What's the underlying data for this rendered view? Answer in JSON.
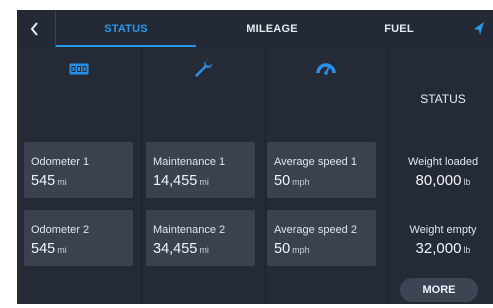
{
  "tabs": [
    {
      "label": "STATUS",
      "active": true
    },
    {
      "label": "MILEAGE",
      "active": false
    },
    {
      "label": "FUEL",
      "active": false
    }
  ],
  "status_heading": "STATUS",
  "icons": [
    "obd-icon",
    "wrench-icon",
    "speedometer-icon"
  ],
  "cards_row1": [
    {
      "label": "Odometer 1",
      "value": "545",
      "unit": "mi"
    },
    {
      "label": "Maintenance 1",
      "value": "14,455",
      "unit": "mi"
    },
    {
      "label": "Average speed 1",
      "value": "50",
      "unit": "mph"
    }
  ],
  "cards_row2": [
    {
      "label": "Odometer 2",
      "value": "545",
      "unit": "mi"
    },
    {
      "label": "Maintenance 2",
      "value": "34,455",
      "unit": "mi"
    },
    {
      "label": "Average speed 2",
      "value": "50",
      "unit": "mph"
    }
  ],
  "weights": [
    {
      "label": "Weight loaded",
      "value": "80,000",
      "unit": "lb"
    },
    {
      "label": "Weight empty",
      "value": "32,000",
      "unit": "lb"
    }
  ],
  "more_label": "MORE",
  "colors": {
    "accent": "#2a97e8",
    "background": "#252b36",
    "card": "#3a4250",
    "icon_obd": "#2a8fe6",
    "icon_wrench": "#2a8fe6",
    "icon_speed": "#2a8fe6"
  }
}
